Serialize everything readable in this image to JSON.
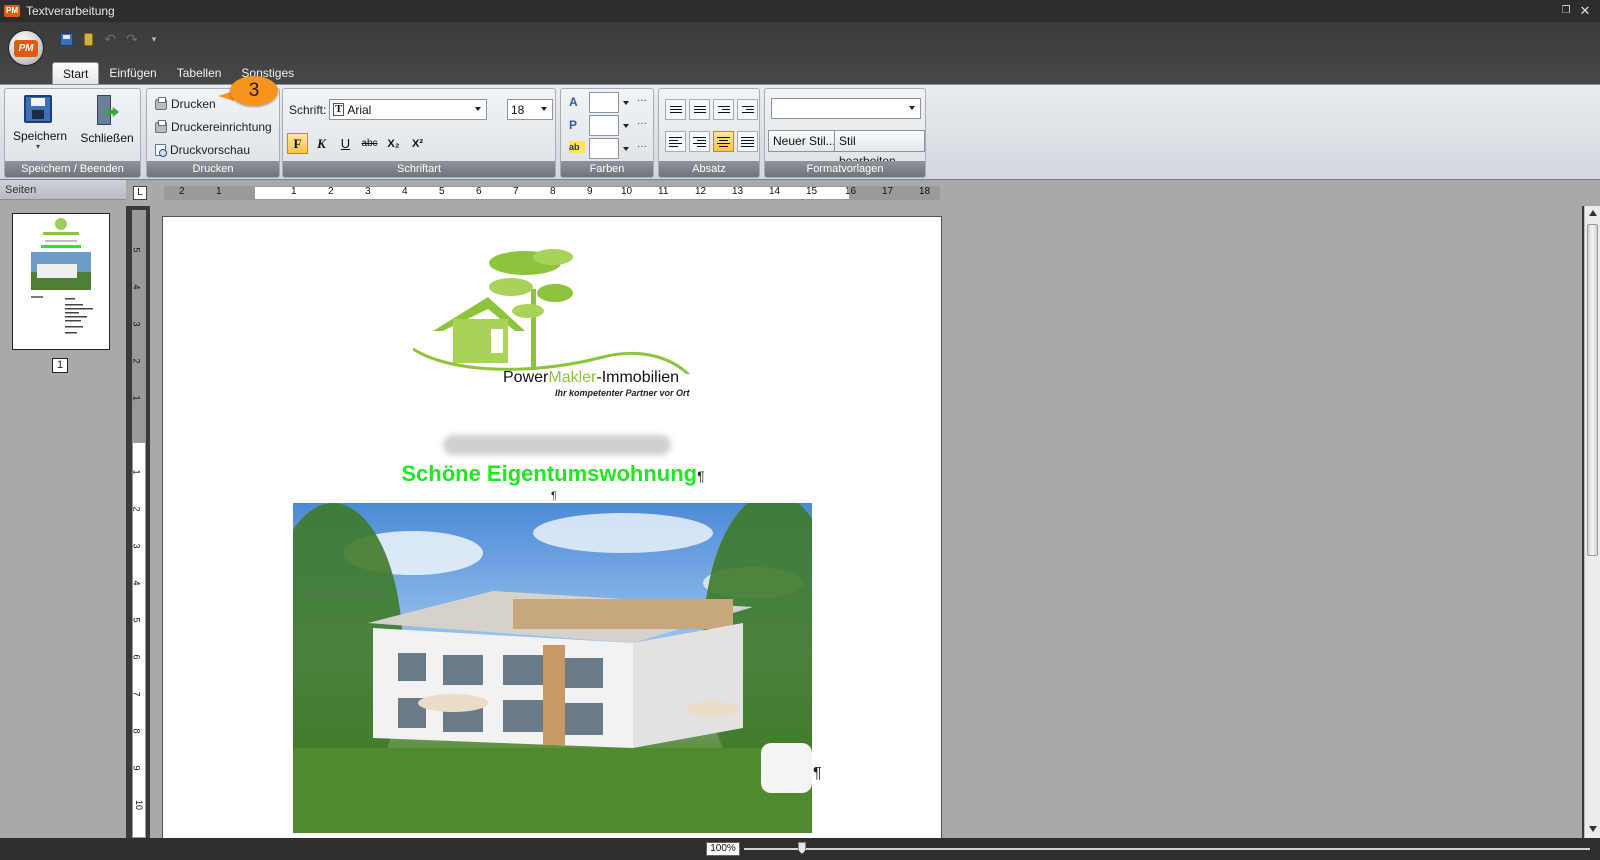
{
  "window": {
    "title": "Textverarbeitung",
    "app_badge": "PM"
  },
  "app_orb": {
    "label": "PM"
  },
  "tabs": [
    {
      "label": "Start"
    },
    {
      "label": "Einfügen"
    },
    {
      "label": "Tabellen"
    },
    {
      "label": "Sonstiges"
    }
  ],
  "ribbon": {
    "save_group": {
      "label": "Speichern / Beenden",
      "save": "Speichern",
      "close": "Schließen"
    },
    "print_group": {
      "label": "Drucken",
      "print": "Drucken",
      "printer_setup": "Druckereinrichtung",
      "print_preview": "Druckvorschau"
    },
    "font_group": {
      "label": "Schriftart",
      "font_label": "Schrift:",
      "font_value": "Arial",
      "size_value": "18",
      "bold": "F",
      "italic": "K",
      "underline": "U",
      "strike": "abc",
      "sub": "X₂",
      "sup": "X²"
    },
    "colors_group": {
      "label": "Farben",
      "text_color_icon": "A",
      "para_color_icon": "P",
      "highlight_icon": "ab"
    },
    "paragraph_group": {
      "label": "Absatz"
    },
    "styles_group": {
      "label": "Formatvorlagen",
      "new_style": "Neuer Stil...",
      "edit_style": "Stil bearbeiten..."
    }
  },
  "callout": {
    "number": "3"
  },
  "pages_pane": {
    "header": "Seiten",
    "page_number": "1"
  },
  "ruler": {
    "corner": "L",
    "h_ticks": [
      "2",
      "1",
      "1",
      "2",
      "3",
      "4",
      "5",
      "6",
      "7",
      "8",
      "9",
      "10",
      "11",
      "12",
      "13",
      "14",
      "15",
      "16",
      "17",
      "18"
    ],
    "v_ticks": [
      "5",
      "4",
      "3",
      "2",
      "1",
      "1",
      "2",
      "3",
      "4",
      "5",
      "6",
      "7",
      "8",
      "9",
      "10"
    ]
  },
  "document": {
    "logo_text_a": "Power",
    "logo_text_b": "Makler",
    "logo_text_c": "-Immobilien",
    "logo_sub": "Ihr kompetenter Partner vor Ort",
    "headline": "Schöne Eigentumswohnung",
    "pilcrow": "¶"
  },
  "statusbar": {
    "zoom": "100%",
    "zoom_level_percent": 100
  }
}
